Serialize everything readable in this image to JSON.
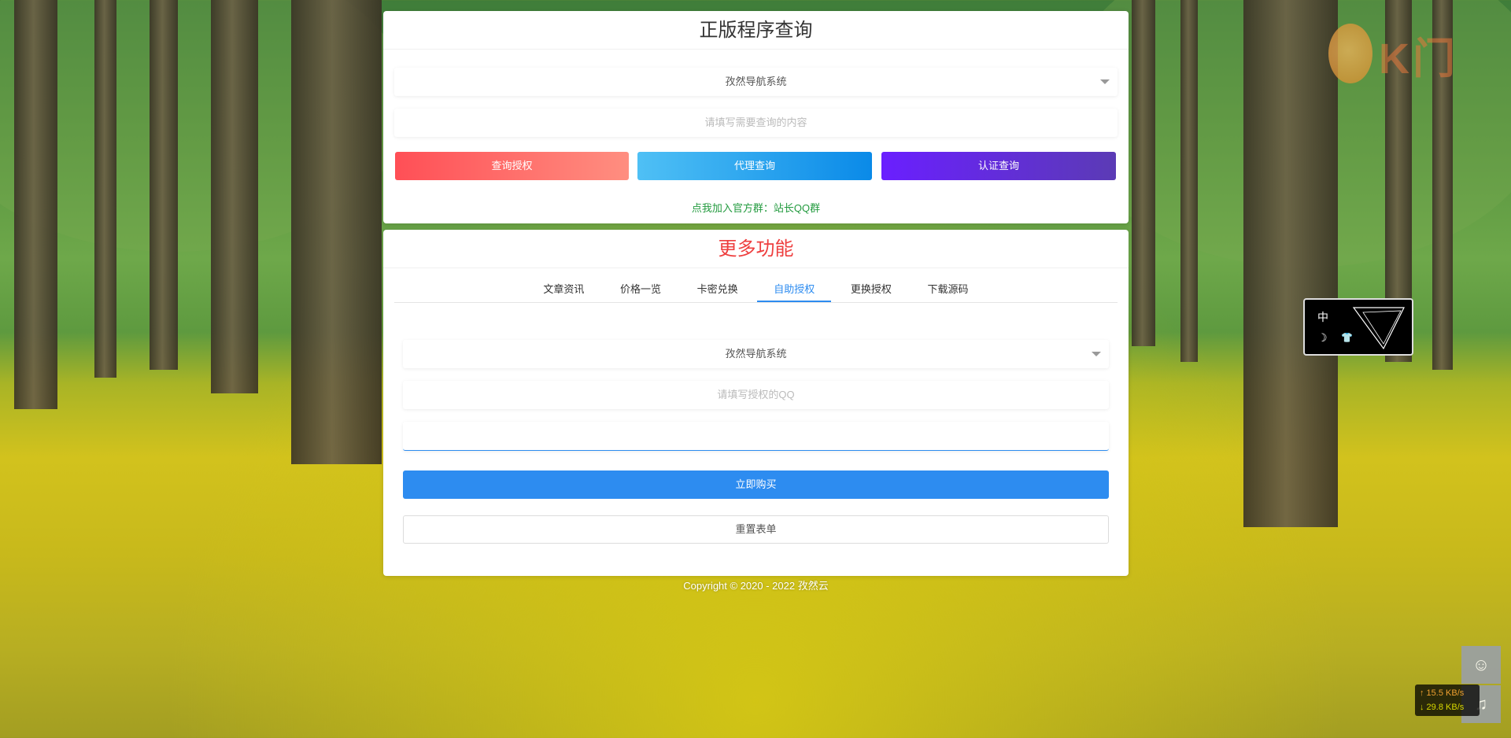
{
  "query_card": {
    "title": "正版程序查询",
    "program_select": "孜然导航系统",
    "query_placeholder": "请填写需要查询的内容",
    "buttons": [
      "查询授权",
      "代理查询",
      "认证查询"
    ],
    "join_link": "点我加入官方群：站长QQ群"
  },
  "features_card": {
    "title": "更多功能",
    "tabs": [
      "文章资讯",
      "价格一览",
      "卡密兑换",
      "自助授权",
      "更换授权",
      "下载源码"
    ],
    "active_tab": "自助授权",
    "program_select": "孜然导航系统",
    "qq_placeholder": "请填写授权的QQ",
    "buy_button": "立即购买",
    "reset_button": "重置表单"
  },
  "footer": {
    "copyright": "Copyright © 2020 - 2022 孜然云"
  },
  "widget": {
    "lang": "中"
  },
  "network_speed": {
    "up": "↑ 15.5 KB/s",
    "down": "↓ 29.8 KB/s"
  },
  "colors": {
    "accent_blue": "#2d8cf0",
    "title_red": "#ee3f3f",
    "link_green": "#239b3f"
  }
}
